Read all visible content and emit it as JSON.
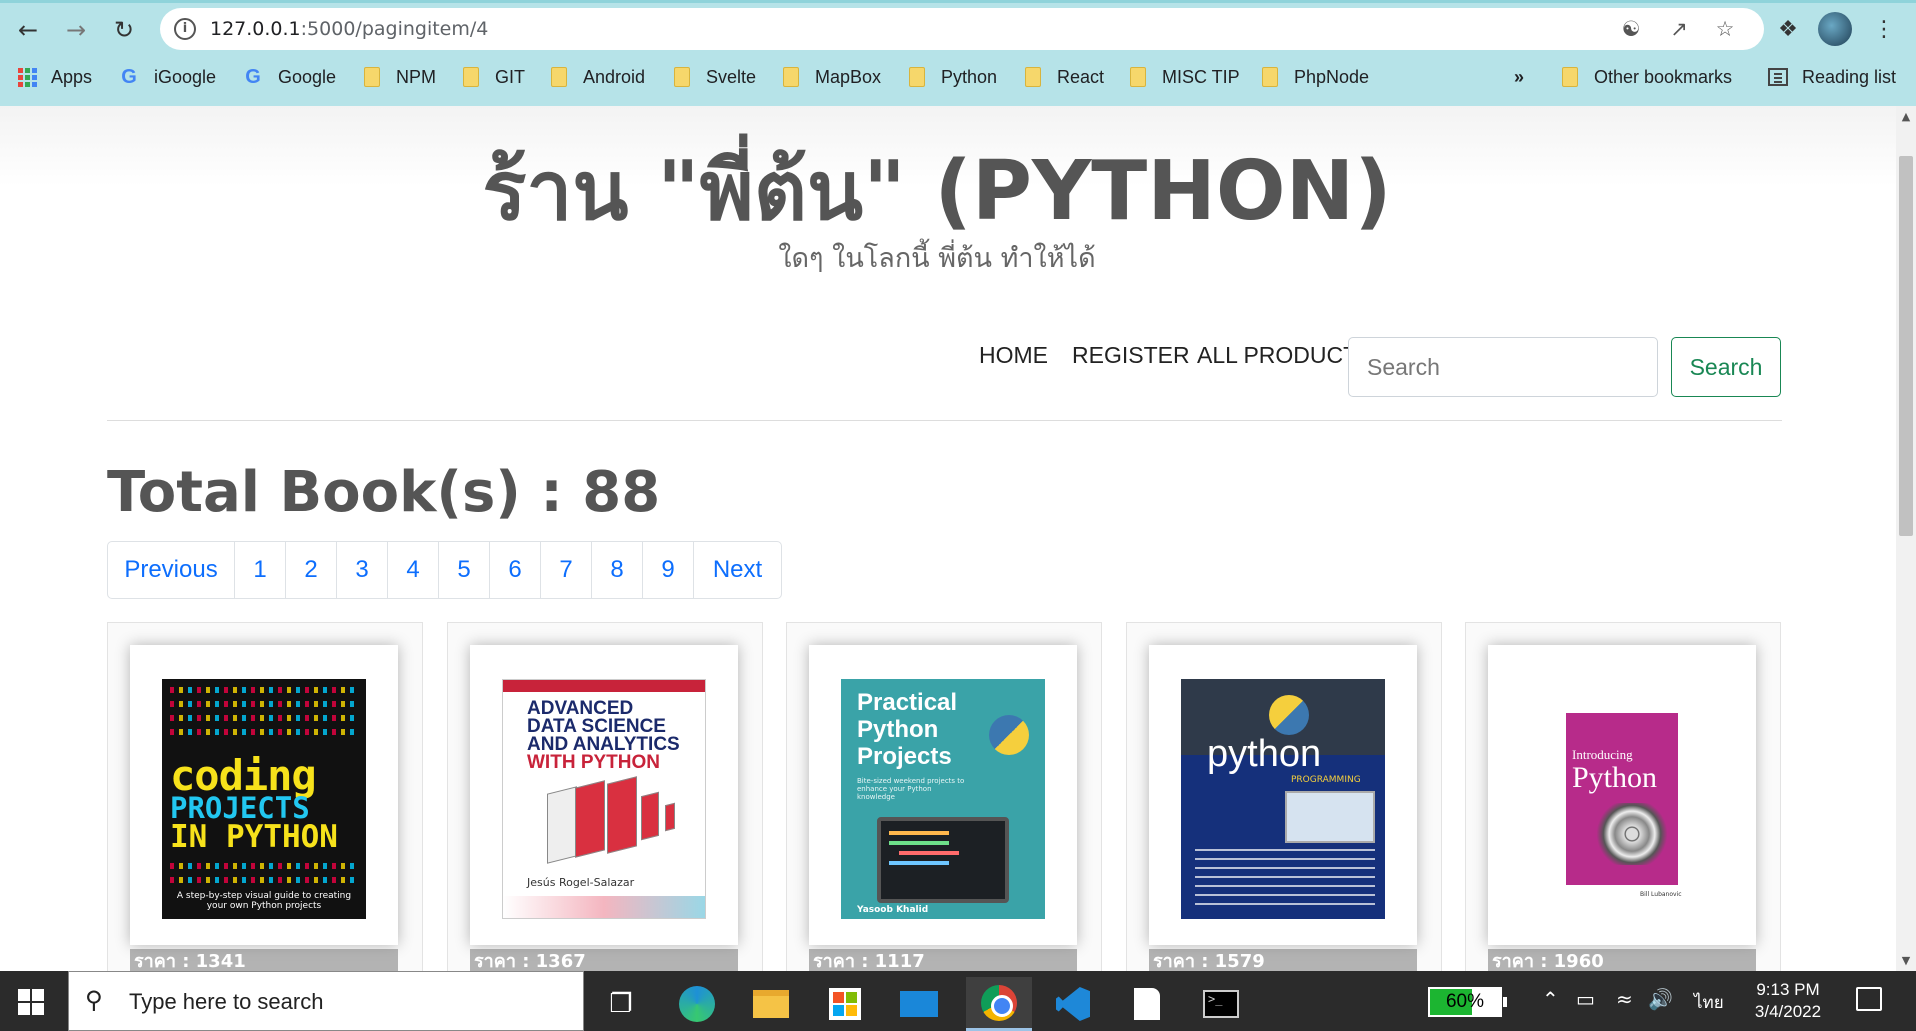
{
  "browser": {
    "url_host": "127.0.0.1",
    "url_path": ":5000/pagingitem/4",
    "bookmarks": [
      "Apps",
      "iGoogle",
      "Google",
      "NPM",
      "GIT",
      "Android",
      "Svelte",
      "MapBox",
      "Python",
      "React",
      "MISC TIP",
      "PhpNode"
    ],
    "overflow": "»",
    "other_bookmarks": "Other bookmarks",
    "reading_list": "Reading list"
  },
  "site": {
    "title": "ร้าน \"พี่ต้น\" (PYTHON)",
    "subtitle": "ใดๆ ในโลกนี้ พี่ต้น ทำให้ได้"
  },
  "nav": {
    "home": "HOME",
    "register": "REGISTER",
    "all_product": "ALL PRODUCT",
    "search_placeholder": "Search",
    "search_button": "Search"
  },
  "catalog": {
    "total_label": "Total Book(s) : 88",
    "pagination": [
      "Previous",
      "1",
      "2",
      "3",
      "4",
      "5",
      "6",
      "7",
      "8",
      "9",
      "Next"
    ],
    "books": [
      {
        "price": "ราคา : 1341",
        "cover_lines": [
          "coding",
          "PROJECTS",
          "IN PYTHON"
        ],
        "cover_note": "A step-by-step visual guide to creating your own Python projects"
      },
      {
        "price": "ราคา : 1367",
        "cover_lines": [
          "ADVANCED",
          "DATA SCIENCE",
          "AND ANALYTICS",
          "WITH PYTHON"
        ],
        "author": "Jesús Rogel-Salazar"
      },
      {
        "price": "ราคา : 1117",
        "cover_lines": [
          "Practical",
          "Python",
          "Projects"
        ],
        "cover_note": "Bite-sized weekend projects to enhance your Python knowledge",
        "author": "Yasoob Khalid"
      },
      {
        "price": "ราคา : 1579",
        "cover_lines": [
          "python"
        ],
        "cover_note": "PROGRAMMING"
      },
      {
        "price": "ราคา : 1960",
        "cover_lines": [
          "Introducing",
          "Python"
        ],
        "author": "Bill Lubanovic"
      }
    ]
  },
  "taskbar": {
    "search_placeholder": "Type here to search",
    "battery": "60%",
    "battery_level": 0.6,
    "language": "ไทย",
    "time": "9:13 PM",
    "date": "3/4/2022"
  }
}
